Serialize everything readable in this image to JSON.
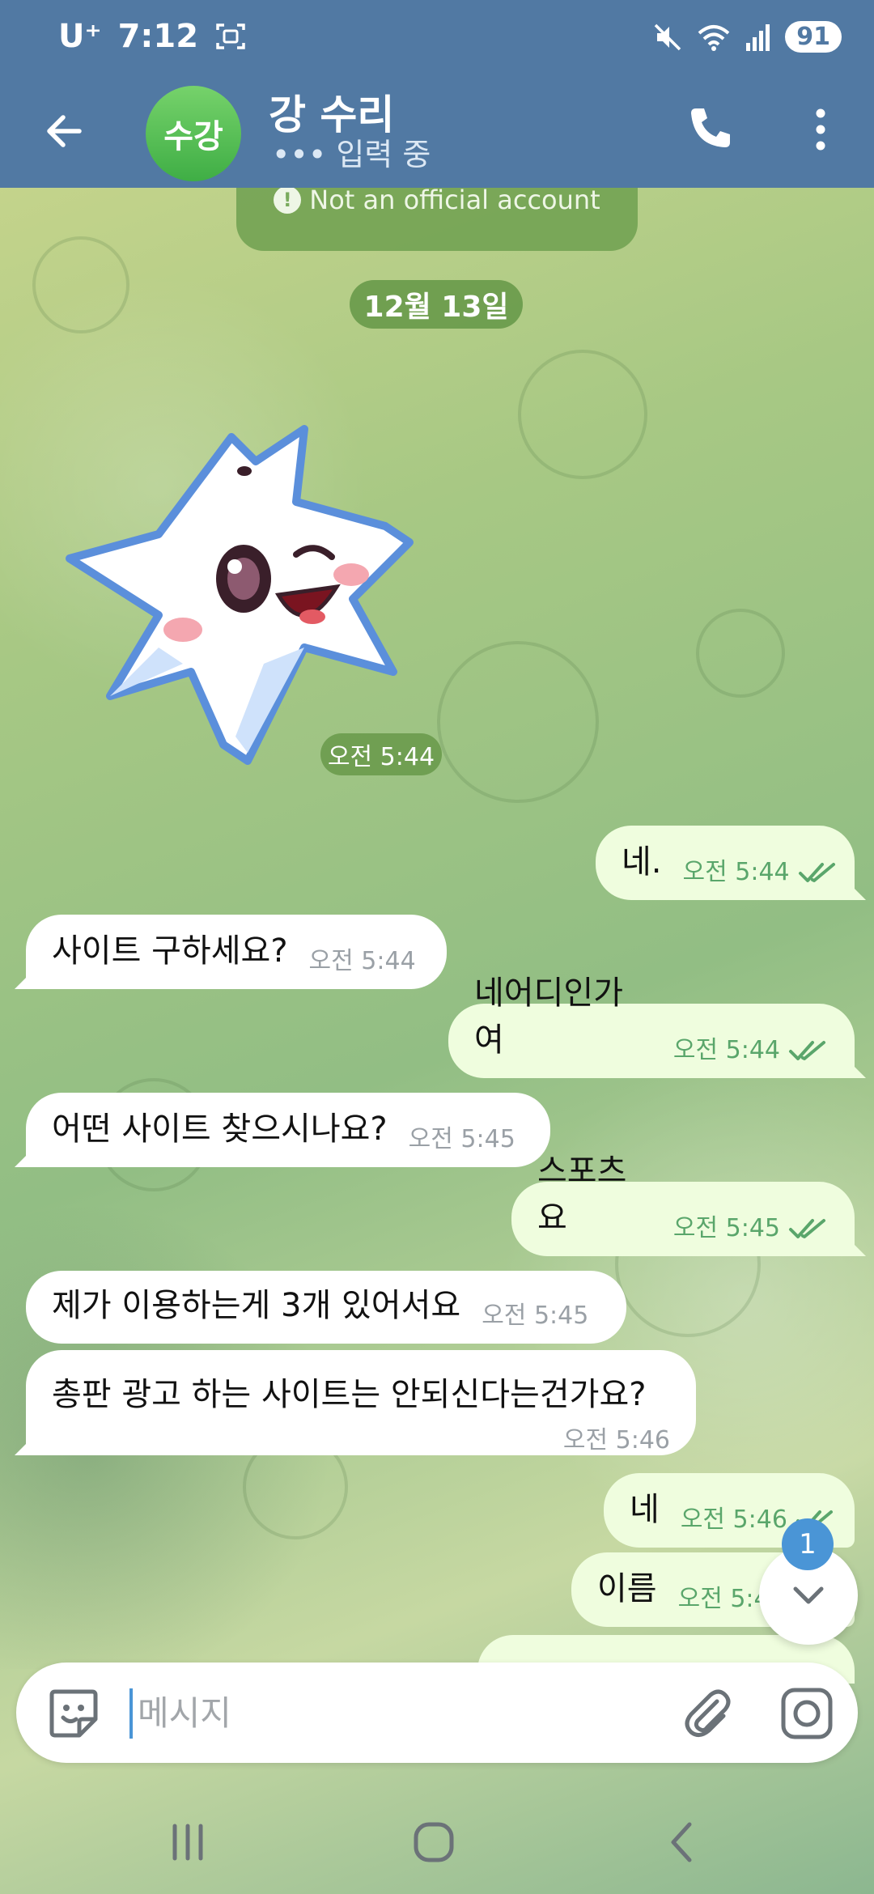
{
  "status_bar": {
    "carrier": "U⁺",
    "time": "7:12",
    "battery": "91"
  },
  "header": {
    "avatar_initials": "수강",
    "contact_name": "강 수리",
    "contact_status": "••• 입력 중"
  },
  "notice": {
    "text": "Not an official account"
  },
  "date_chip": "12월 13일",
  "sticker": {
    "time": "오전 5:44"
  },
  "messages": [
    {
      "dir": "out",
      "text": "네.",
      "time": "오전 5:44",
      "read": true
    },
    {
      "dir": "in",
      "text": "사이트 구하세요?",
      "time": "오전 5:44"
    },
    {
      "dir": "out",
      "text": "네어디인가여",
      "time": "오전 5:44",
      "read": true
    },
    {
      "dir": "in",
      "text": "어떤 사이트 찾으시나요?",
      "time": "오전 5:45"
    },
    {
      "dir": "out",
      "text": "스포츠요",
      "time": "오전 5:45",
      "read": true
    },
    {
      "dir": "in",
      "text": "제가 이용하는게 3개 있어서요",
      "time": "오전 5:45"
    },
    {
      "dir": "in",
      "text": "총판 광고 하는 사이트는 안되신다는건가요?",
      "time": "오전 5:46"
    },
    {
      "dir": "out",
      "text": "네",
      "time": "오전 5:46",
      "read": true
    },
    {
      "dir": "out",
      "text": "이름",
      "time": "오전 5:4"
    }
  ],
  "scroll_button": {
    "unread_count": "1"
  },
  "composer": {
    "placeholder": "메시지"
  },
  "icons": {
    "back": "arrow-left-icon",
    "call": "phone-icon",
    "more": "more-vertical-icon",
    "emoji": "sticker-icon",
    "attach": "paperclip-icon",
    "camera": "camera-icon",
    "scroll": "chevron-down-icon"
  },
  "colors": {
    "header": "#5179a3",
    "avatar": "#4caf50",
    "incoming_bubble": "#ffffff",
    "outgoing_bubble": "#effdde",
    "read_ticks": "#5aa66b",
    "accent": "#4a95d6"
  }
}
